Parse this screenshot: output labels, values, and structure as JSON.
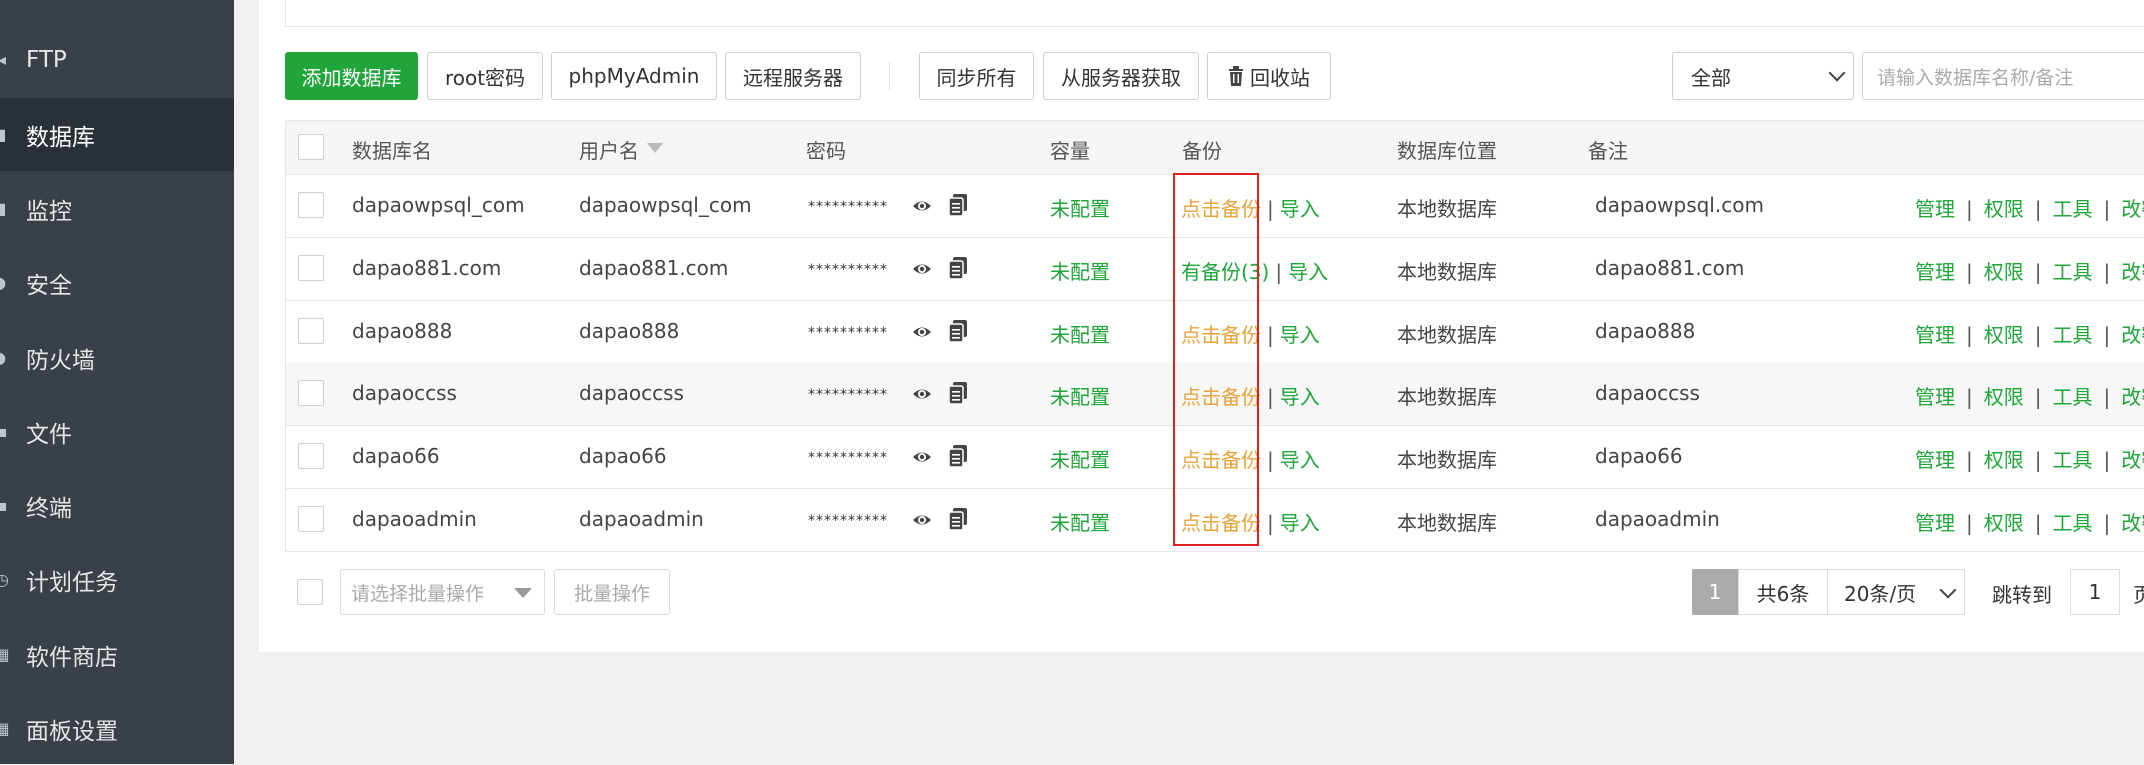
{
  "sidebar": {
    "items": [
      {
        "label": "FTP",
        "icon": "ftp-icon",
        "active": false
      },
      {
        "label": "数据库",
        "icon": "database-icon",
        "active": true
      },
      {
        "label": "监控",
        "icon": "monitor-icon",
        "active": false
      },
      {
        "label": "安全",
        "icon": "shield-icon",
        "active": false
      },
      {
        "label": "防火墙",
        "icon": "firewall-icon",
        "active": false
      },
      {
        "label": "文件",
        "icon": "folder-icon",
        "active": false
      },
      {
        "label": "终端",
        "icon": "terminal-icon",
        "active": false
      },
      {
        "label": "计划任务",
        "icon": "clock-icon",
        "active": false
      },
      {
        "label": "软件商店",
        "icon": "store-icon",
        "active": false
      },
      {
        "label": "面板设置",
        "icon": "settings-icon",
        "active": false
      }
    ]
  },
  "toolbar": {
    "add_db": "添加数据库",
    "root_pw": "root密码",
    "phpmyadmin": "phpMyAdmin",
    "remote_server": "远程服务器",
    "sync_all": "同步所有",
    "fetch_from_server": "从服务器获取",
    "recycle_bin": "回收站",
    "filter_value": "全部",
    "search_placeholder": "请输入数据库名称/备注"
  },
  "table": {
    "headers": {
      "name": "数据库名",
      "user": "用户名",
      "password": "密码",
      "capacity": "容量",
      "backup": "备份",
      "location": "数据库位置",
      "remark": "备注"
    },
    "rows": [
      {
        "name": "dapaowpsql_com",
        "user": "dapaowpsql_com",
        "password": "**********",
        "capacity": "未配置",
        "backup": "点击备份",
        "import": "导入",
        "location": "本地数据库",
        "remark": "dapaowpsql.com"
      },
      {
        "name": "dapao881.com",
        "user": "dapao881.com",
        "password": "**********",
        "capacity": "未配置",
        "backup": "有备份(3)",
        "import": "导入",
        "location": "本地数据库",
        "remark": "dapao881.com"
      },
      {
        "name": "dapao888",
        "user": "dapao888",
        "password": "**********",
        "capacity": "未配置",
        "backup": "点击备份",
        "import": "导入",
        "location": "本地数据库",
        "remark": "dapao888"
      },
      {
        "name": "dapaoccss",
        "user": "dapaoccss",
        "password": "**********",
        "capacity": "未配置",
        "backup": "点击备份",
        "import": "导入",
        "location": "本地数据库",
        "remark": "dapaoccss"
      },
      {
        "name": "dapao66",
        "user": "dapao66",
        "password": "**********",
        "capacity": "未配置",
        "backup": "点击备份",
        "import": "导入",
        "location": "本地数据库",
        "remark": "dapao66"
      },
      {
        "name": "dapaoadmin",
        "user": "dapaoadmin",
        "password": "**********",
        "capacity": "未配置",
        "backup": "点击备份",
        "import": "导入",
        "location": "本地数据库",
        "remark": "dapaoadmin"
      }
    ],
    "ops": {
      "manage": "管理",
      "permission": "权限",
      "tools": "工具",
      "modify": "改密"
    }
  },
  "footer": {
    "batch_placeholder": "请选择批量操作",
    "batch_button": "批量操作",
    "current_page": "1",
    "total": "共6条",
    "per_page": "20条/页",
    "jump_label": "跳转到",
    "jump_value": "1",
    "page_suffix": "页"
  },
  "colors": {
    "accent": "#20a53a",
    "backup_link": "#e8a33b",
    "highlight_box": "#e02020",
    "sidebar_bg": "#394048"
  }
}
